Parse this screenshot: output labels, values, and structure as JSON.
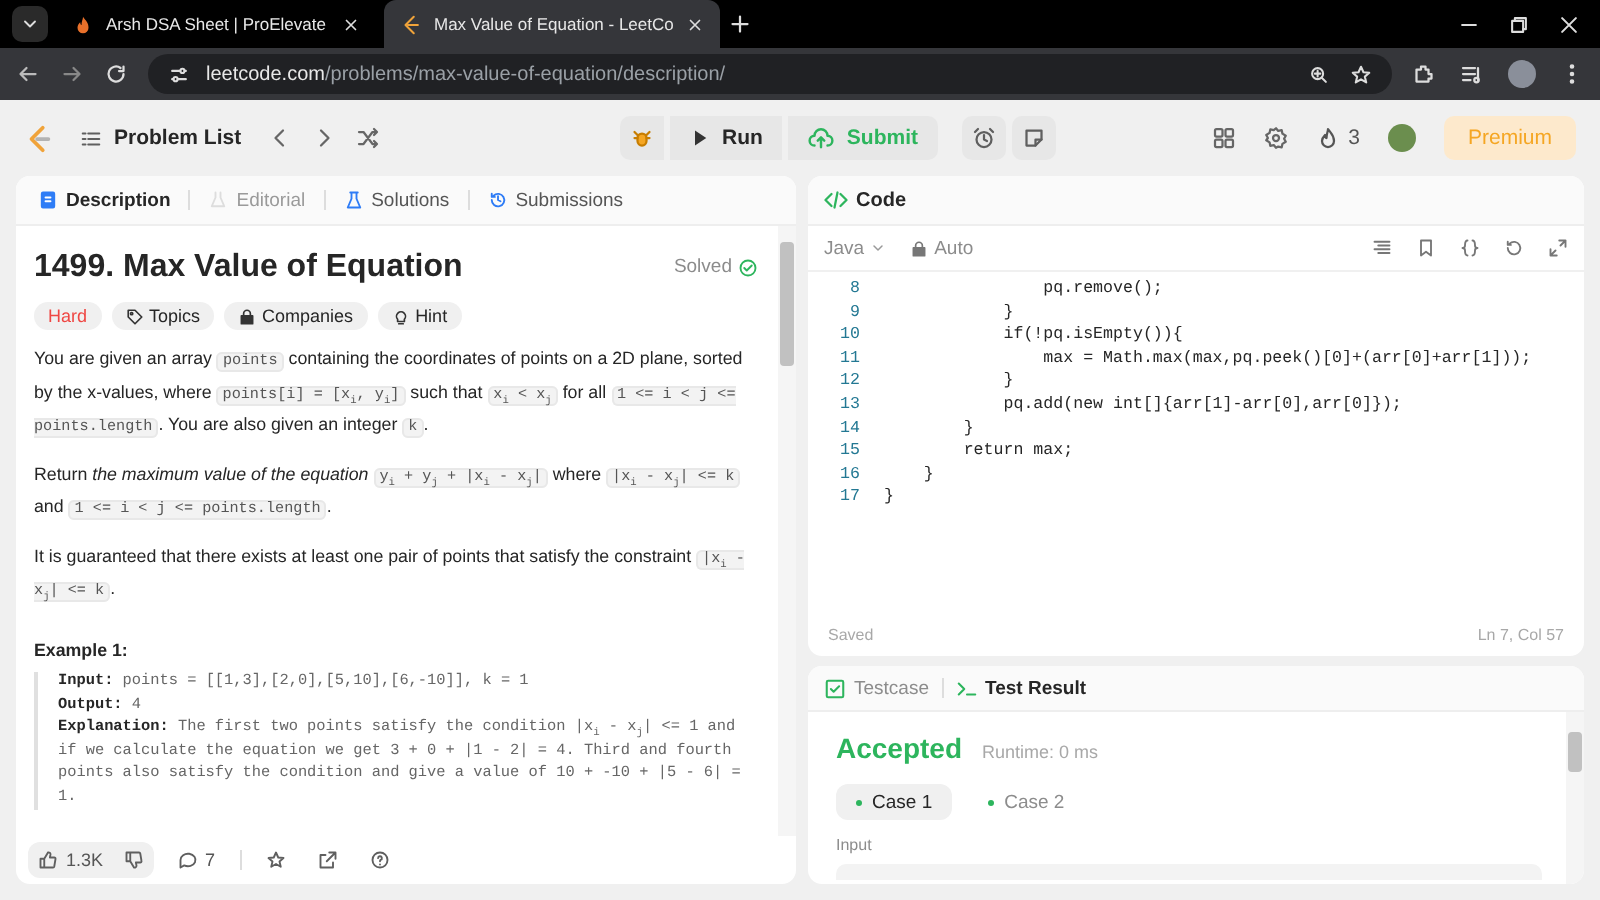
{
  "browser": {
    "tabs": [
      {
        "title": "Arsh DSA Sheet | ProElevate",
        "selected": false
      },
      {
        "title": "Max Value of Equation - LeetCo",
        "selected": true
      }
    ],
    "url": {
      "host": "leetcode.com",
      "path": "/problems/max-value-of-equation/description/"
    }
  },
  "toolbar": {
    "problem_list": "Problem List",
    "run": "Run",
    "submit": "Submit",
    "streak": "3",
    "premium": "Premium"
  },
  "description_tabs": [
    {
      "label": "Description",
      "selected": true,
      "disabled": false
    },
    {
      "label": "Editorial",
      "selected": false,
      "disabled": true
    },
    {
      "label": "Solutions",
      "selected": false,
      "disabled": false
    },
    {
      "label": "Submissions",
      "selected": false,
      "disabled": false
    }
  ],
  "problem": {
    "title": "1499. Max Value of Equation",
    "status": "Solved",
    "difficulty": "Hard",
    "tags": [
      "Topics",
      "Companies",
      "Hint"
    ],
    "paragraphs": [
      [
        {
          "kind": "text",
          "text": "You are given an array "
        },
        {
          "kind": "code",
          "text": "points"
        },
        {
          "kind": "text",
          "text": " containing the coordinates of points on a 2D plane, sorted by the x-values, where "
        },
        {
          "kind": "code",
          "text": "points[i] = [x$_{i}$, y$_{i}$]"
        },
        {
          "kind": "text",
          "text": " such that "
        },
        {
          "kind": "code",
          "text": "x$_{i}$ < x$_{j}$"
        },
        {
          "kind": "text",
          "text": " for all "
        },
        {
          "kind": "code",
          "text": "1 <= i < j <= points.length"
        },
        {
          "kind": "text",
          "text": ". You are also given an integer "
        },
        {
          "kind": "code",
          "text": "k"
        },
        {
          "kind": "text",
          "text": "."
        }
      ],
      [
        {
          "kind": "text",
          "text": "Return *the maximum value of the equation* "
        },
        {
          "kind": "code",
          "text": "y$_{i}$ + y$_{j}$ + |x$_{i}$ - x$_{j}$|"
        },
        {
          "kind": "text",
          "text": " where "
        },
        {
          "kind": "code",
          "text": "|x$_{i}$ - x$_{j}$| <= k"
        },
        {
          "kind": "text",
          "text": " and "
        },
        {
          "kind": "code",
          "text": "1 <= i < j <= points.length"
        },
        {
          "kind": "text",
          "text": "."
        }
      ],
      [
        {
          "kind": "text",
          "text": "It is guaranteed that there exists at least one pair of points that satisfy the constraint "
        },
        {
          "kind": "code",
          "text": "|x$_{i}$ - x$_{j}$| <= k"
        },
        {
          "kind": "text",
          "text": "."
        }
      ]
    ],
    "example": {
      "heading": "Example 1:",
      "lines": [
        {
          "label": "Input:",
          "text": "points = [[1,3],[2,0],[5,10],[6,-10]], k = 1"
        },
        {
          "label": "Output:",
          "text": "4"
        },
        {
          "label": "Explanation:",
          "text": "The first two points satisfy the condition |x$_{i}$ - x$_{j}$| <= 1 and if we calculate the equation we get 3 + 0 + |1 - 2| = 4. Third and fourth points also satisfy the condition and give a value of 10 + -10 + |5 - 6| = 1."
        }
      ]
    }
  },
  "footer": {
    "likes": "1.3K",
    "comments": "7"
  },
  "code_panel": {
    "title": "Code",
    "language": "Java",
    "mode": "Auto",
    "lines": [
      {
        "num": "8",
        "text": "                pq.remove();"
      },
      {
        "num": "9",
        "text": "            }"
      },
      {
        "num": "10",
        "text": "            if(!pq.isEmpty()){"
      },
      {
        "num": "11",
        "text": "                max = Math.max(max,pq.peek()[0]+(arr[0]+arr[1]));"
      },
      {
        "num": "12",
        "text": "            }"
      },
      {
        "num": "13",
        "text": "            pq.add(new int[]{arr[1]-arr[0],arr[0]});"
      },
      {
        "num": "14",
        "text": "        }"
      },
      {
        "num": "15",
        "text": "        return max;"
      },
      {
        "num": "16",
        "text": "    }"
      },
      {
        "num": "17",
        "text": "}"
      }
    ],
    "status": "Saved",
    "cursor": "Ln 7, Col 57"
  },
  "result_panel": {
    "tabs": [
      {
        "label": "Testcase",
        "selected": false
      },
      {
        "label": "Test Result",
        "selected": true
      }
    ],
    "verdict": "Accepted",
    "runtime": "Runtime: 0 ms",
    "cases": [
      {
        "label": "Case 1",
        "selected": true
      },
      {
        "label": "Case 2",
        "selected": false
      }
    ],
    "input_label": "Input"
  }
}
